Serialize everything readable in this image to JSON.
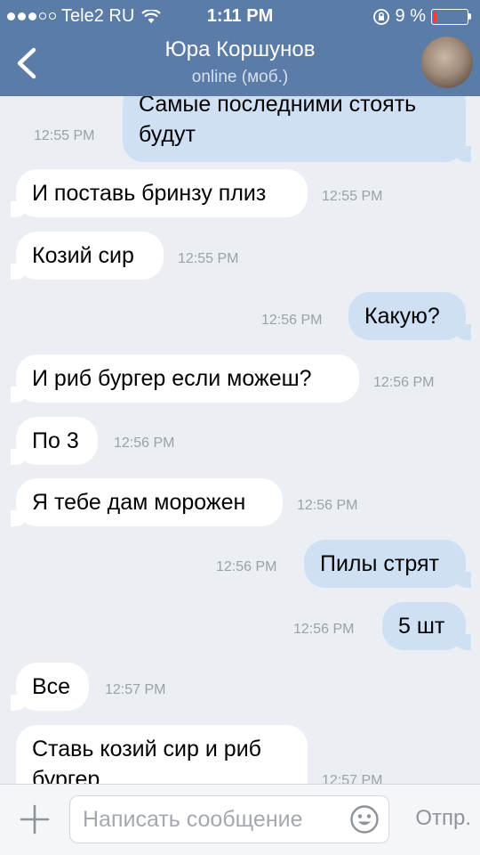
{
  "status_bar": {
    "carrier": "Tele2 RU",
    "time": "1:11 PM",
    "battery_percent": "9 %",
    "battery_level": 0.09
  },
  "header": {
    "back_icon": "chevron-left-icon",
    "title": "Юра Коршунов",
    "subtitle": "online (моб.)"
  },
  "messages": [
    {
      "direction": "out",
      "text": "Самые последними стоять будут",
      "time": "12:55 PM"
    },
    {
      "direction": "in",
      "text": "И поставь бринзу плиз",
      "time": "12:55 PM"
    },
    {
      "direction": "in",
      "text": "Козий сир",
      "time": "12:55 PM"
    },
    {
      "direction": "out",
      "text": "Какую?",
      "time": "12:56 PM"
    },
    {
      "direction": "in",
      "text": "И риб бургер если можеш?",
      "time": "12:56 PM"
    },
    {
      "direction": "in",
      "text": "По 3",
      "time": "12:56 PM"
    },
    {
      "direction": "in",
      "text": "Я тебе дам морожен",
      "time": "12:56 PM"
    },
    {
      "direction": "out",
      "text": "Пилы стрят",
      "time": "12:56 PM"
    },
    {
      "direction": "out",
      "text": "5 шт",
      "time": "12:56 PM"
    },
    {
      "direction": "in",
      "text": "Все",
      "time": "12:57 PM"
    },
    {
      "direction": "in",
      "text": "Ставь козий сир и риб бургер",
      "time": "12:57 PM"
    }
  ],
  "composer": {
    "placeholder": "Написать сообщение",
    "send_label": "Отпр.",
    "attach_icon": "plus-icon",
    "emoji_icon": "smiley-icon"
  },
  "colors": {
    "header_bg": "#5a7ca6",
    "chat_bg": "#ebeef2",
    "incoming_bubble": "#ffffff",
    "outgoing_bubble": "#cfe0f5"
  }
}
